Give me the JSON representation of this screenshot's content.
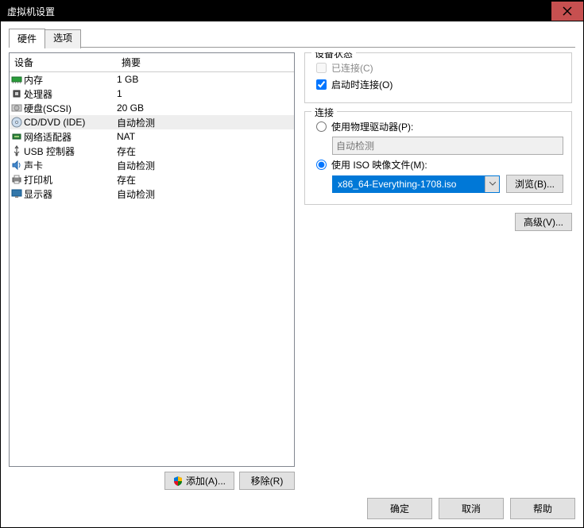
{
  "window": {
    "title": "虚拟机设置"
  },
  "tabs": {
    "hardware": "硬件",
    "options": "选项"
  },
  "hw_header": {
    "device": "设备",
    "summary": "摘要"
  },
  "hardware": [
    {
      "label": "内存",
      "summary": "1 GB",
      "icon": "memory"
    },
    {
      "label": "处理器",
      "summary": "1",
      "icon": "cpu"
    },
    {
      "label": "硬盘(SCSI)",
      "summary": "20 GB",
      "icon": "hdd"
    },
    {
      "label": "CD/DVD (IDE)",
      "summary": "自动检测",
      "icon": "cd",
      "selected": true
    },
    {
      "label": "网络适配器",
      "summary": "NAT",
      "icon": "net"
    },
    {
      "label": "USB 控制器",
      "summary": "存在",
      "icon": "usb"
    },
    {
      "label": "声卡",
      "summary": "自动检测",
      "icon": "sound"
    },
    {
      "label": "打印机",
      "summary": "存在",
      "icon": "printer"
    },
    {
      "label": "显示器",
      "summary": "自动检测",
      "icon": "monitor"
    }
  ],
  "left_buttons": {
    "add": "添加(A)...",
    "remove": "移除(R)"
  },
  "status_group": {
    "title": "设备状态",
    "connected": "已连接(C)",
    "connect_power": "启动时连接(O)"
  },
  "connect_group": {
    "title": "连接",
    "physical": "使用物理驱动器(P):",
    "physical_combo": "自动检测",
    "iso": "使用 ISO 映像文件(M):",
    "iso_value": "x86_64-Everything-1708.iso",
    "browse": "浏览(B)..."
  },
  "advanced": "高级(V)...",
  "footer": {
    "ok": "确定",
    "cancel": "取消",
    "help": "帮助"
  }
}
